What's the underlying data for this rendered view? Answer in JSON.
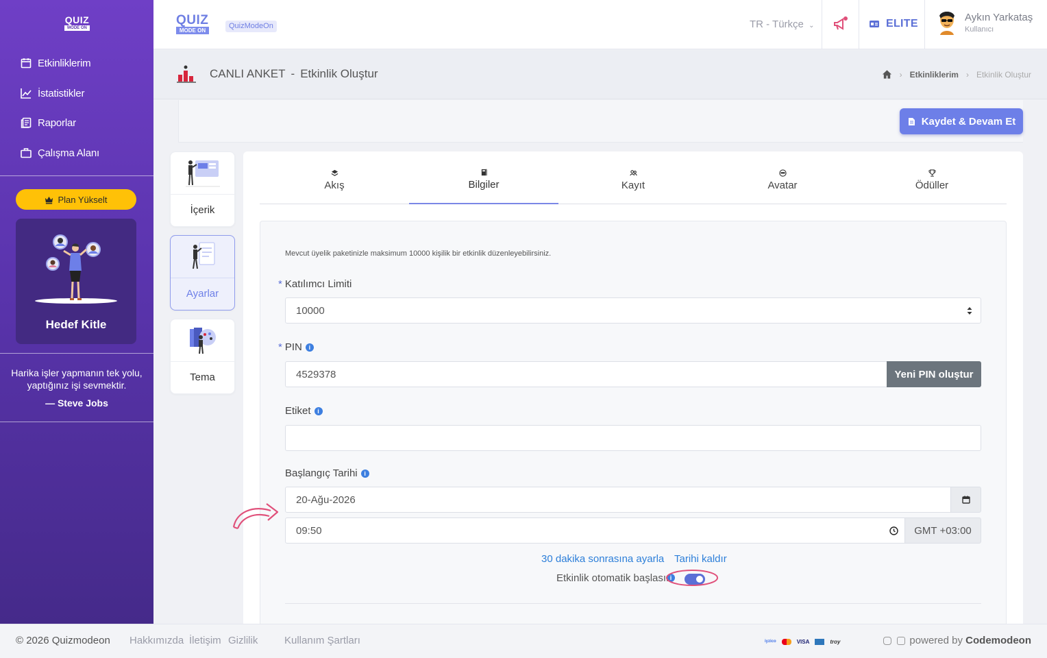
{
  "sidebar": {
    "logo": {
      "line1": "QUIZ",
      "line2": "MODE ON"
    },
    "items": [
      {
        "label": "Etkinliklerim",
        "icon": "calendar-icon"
      },
      {
        "label": "İstatistikler",
        "icon": "chart-line-icon"
      },
      {
        "label": "Raporlar",
        "icon": "report-icon"
      },
      {
        "label": "Çalışma Alanı",
        "icon": "briefcase-icon"
      }
    ],
    "plan_button": "Plan Yükselt",
    "target_card_title": "Hedef Kitle",
    "quote": "Harika işler yapmanın tek yolu, yaptığınız işi sevmektir.",
    "quote_author": "— Steve Jobs"
  },
  "topbar": {
    "logo": {
      "line1": "QUIZ",
      "line2": "MODE ON"
    },
    "badge": "QuizModeOn",
    "language": "TR - Türkçe",
    "plan": "ELITE",
    "user_name": "Aykın Yarkataş",
    "user_role": "Kullanıcı"
  },
  "page_header": {
    "title": "CANLI ANKET",
    "separator": "-",
    "subtitle": "Etkinlik Oluştur",
    "breadcrumb": [
      "Etkinliklerim",
      "Etkinlik Oluştur"
    ]
  },
  "actions": {
    "save_label": "Kaydet & Devam Et"
  },
  "side_steps": [
    {
      "label": "İçerik"
    },
    {
      "label": "Ayarlar",
      "active": true
    },
    {
      "label": "Tema"
    }
  ],
  "tabs": [
    {
      "label": "Akış",
      "icon": "layers-icon"
    },
    {
      "label": "Bilgiler",
      "icon": "book-icon",
      "active": true
    },
    {
      "label": "Kayıt",
      "icon": "users-icon"
    },
    {
      "label": "Avatar",
      "icon": "mask-icon"
    },
    {
      "label": "Ödüller",
      "icon": "trophy-icon"
    }
  ],
  "form": {
    "info_note": "Mevcut üyelik paketinizle maksimum 10000 kişilik bir etkinlik düzenleyebilirsiniz.",
    "participant_limit": {
      "label": "Katılımcı Limiti",
      "required": "*",
      "value": "10000"
    },
    "pin": {
      "label": "PIN",
      "required": "*",
      "value": "4529378",
      "button": "Yeni PIN oluştur"
    },
    "tag": {
      "label": "Etiket",
      "value": ""
    },
    "start_date": {
      "label": "Başlangıç Tarihi",
      "date": "20-Ağu-2026",
      "time": "09:50",
      "timezone": "GMT +03:00"
    },
    "links": {
      "set_30": "30 dakika sonrasına ayarla",
      "remove": "Tarihi kaldır"
    },
    "auto_start": {
      "label": "Etkinlik otomatik başlasın",
      "checked": true
    }
  },
  "footer": {
    "copyright": "© 2026 Quizmodeon",
    "links": [
      "Hakkımızda",
      "İletişim",
      "Gizlilik",
      "Kullanım Şartları"
    ],
    "payment_logos": [
      "iyzico",
      "mastercard",
      "VISA",
      "amex",
      "troy"
    ],
    "powered_prefix": "powered by",
    "powered_brand": "Codemodeon"
  },
  "colors": {
    "sidebar_top": "#6f3fc6",
    "sidebar_bottom": "#452a8a",
    "accent": "#6d7fe8",
    "plan_button": "#ffc107",
    "link": "#2d7fd9",
    "annotation": "#e0507a"
  }
}
